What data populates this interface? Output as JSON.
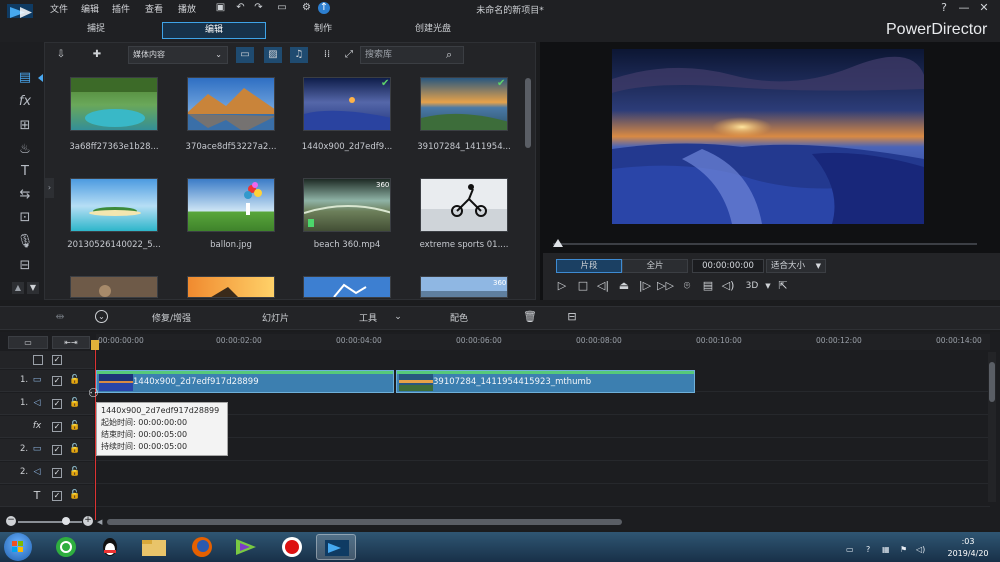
{
  "app": {
    "title": "未命名的新项目*",
    "brand": "PowerDirector",
    "menu": [
      "文件",
      "编辑",
      "插件",
      "查看",
      "播放"
    ],
    "help": "?",
    "minimize": "—",
    "maximize": "☐",
    "close": "✕"
  },
  "modes": [
    "捕捉",
    "编辑",
    "制作",
    "创建光盘"
  ],
  "library": {
    "dropdown": "媒体内容",
    "search_placeholder": "搜索库",
    "items": [
      {
        "label": "3a68ff27363e1b28...",
        "checked": false,
        "tag": ""
      },
      {
        "label": "370ace8df53227a2...",
        "checked": false,
        "tag": ""
      },
      {
        "label": "1440x900_2d7edf9...",
        "checked": true,
        "tag": ""
      },
      {
        "label": "39107284_1411954...",
        "checked": true,
        "tag": ""
      },
      {
        "label": "20130526140022_5...",
        "checked": false,
        "tag": ""
      },
      {
        "label": "ballon.jpg",
        "checked": false,
        "tag": ""
      },
      {
        "label": "beach 360.mp4",
        "checked": false,
        "tag": "360"
      },
      {
        "label": "extreme sports 01....",
        "checked": false,
        "tag": ""
      },
      {
        "label": "",
        "checked": false,
        "tag": ""
      },
      {
        "label": "",
        "checked": false,
        "tag": ""
      },
      {
        "label": "",
        "checked": false,
        "tag": ""
      },
      {
        "label": "",
        "checked": false,
        "tag": "360"
      }
    ]
  },
  "preview": {
    "seg_clip": "片段",
    "seg_movie": "全片",
    "timecode": "00:00:00:00",
    "fit": "适合大小",
    "three_d": "3D"
  },
  "timeline_toolbar": {
    "fix": "修复/增强",
    "slideshow": "幻灯片",
    "tools": "工具",
    "color": "配色"
  },
  "ruler": [
    "00:00:00:00",
    "00:00:02:00",
    "00:00:04:00",
    "00:00:06:00",
    "00:00:08:00",
    "00:00:10:00",
    "00:00:12:00",
    "00:00:14:00"
  ],
  "tracks": [
    {
      "num": "",
      "icon": "☐"
    },
    {
      "num": "1.",
      "icon": "▭"
    },
    {
      "num": "1.",
      "icon": "◁"
    },
    {
      "num": "",
      "icon": "fx"
    },
    {
      "num": "2.",
      "icon": "▭"
    },
    {
      "num": "2.",
      "icon": "◁"
    },
    {
      "num": "",
      "icon": "T"
    }
  ],
  "clips": [
    {
      "label": "1440x900_2d7edf917d28899"
    },
    {
      "label": "39107284_1411954415923_mthumb"
    }
  ],
  "tooltip": {
    "name": "1440x900_2d7edf917d28899",
    "start": "起始时间: 00:00:00:00",
    "end": "结束时间: 00:00:05:00",
    "duration": "持续时间:  00:00:05:00"
  },
  "taskbar": {
    "time": ":03",
    "date": "2019/4/20"
  }
}
